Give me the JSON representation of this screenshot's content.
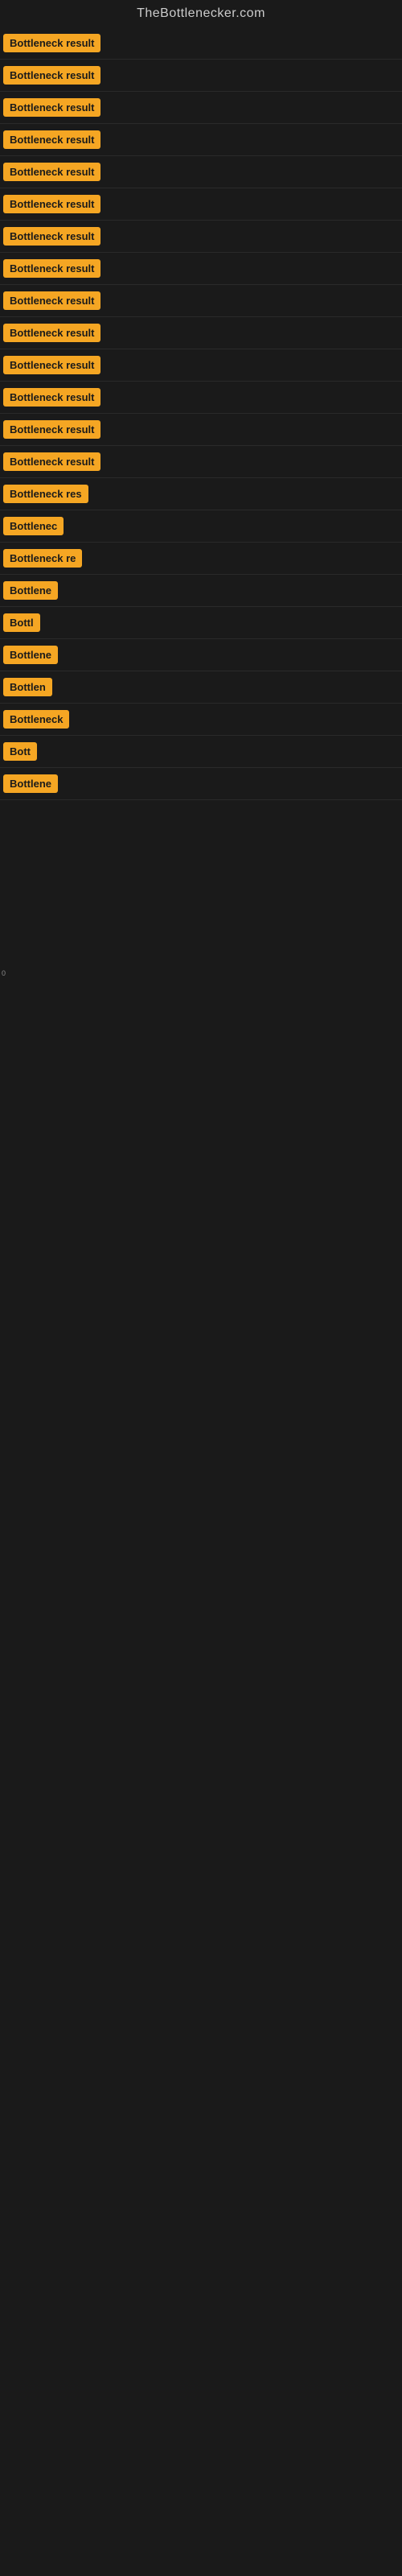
{
  "site": {
    "title": "TheBottlenecker.com"
  },
  "badges": [
    {
      "label": "Bottleneck result",
      "width": 140
    },
    {
      "label": "Bottleneck result",
      "width": 140
    },
    {
      "label": "Bottleneck result",
      "width": 140
    },
    {
      "label": "Bottleneck result",
      "width": 140
    },
    {
      "label": "Bottleneck result",
      "width": 140
    },
    {
      "label": "Bottleneck result",
      "width": 140
    },
    {
      "label": "Bottleneck result",
      "width": 140
    },
    {
      "label": "Bottleneck result",
      "width": 140
    },
    {
      "label": "Bottleneck result",
      "width": 140
    },
    {
      "label": "Bottleneck result",
      "width": 140
    },
    {
      "label": "Bottleneck result",
      "width": 140
    },
    {
      "label": "Bottleneck result",
      "width": 140
    },
    {
      "label": "Bottleneck result",
      "width": 140
    },
    {
      "label": "Bottleneck result",
      "width": 140
    },
    {
      "label": "Bottleneck res",
      "width": 110
    },
    {
      "label": "Bottlenec",
      "width": 80
    },
    {
      "label": "Bottleneck re",
      "width": 100
    },
    {
      "label": "Bottlene",
      "width": 75
    },
    {
      "label": "Bottl",
      "width": 50
    },
    {
      "label": "Bottlene",
      "width": 75
    },
    {
      "label": "Bottlen",
      "width": 65
    },
    {
      "label": "Bottleneck",
      "width": 85
    },
    {
      "label": "Bott",
      "width": 45
    },
    {
      "label": "Bottlene",
      "width": 75
    }
  ],
  "footer_label": "0"
}
